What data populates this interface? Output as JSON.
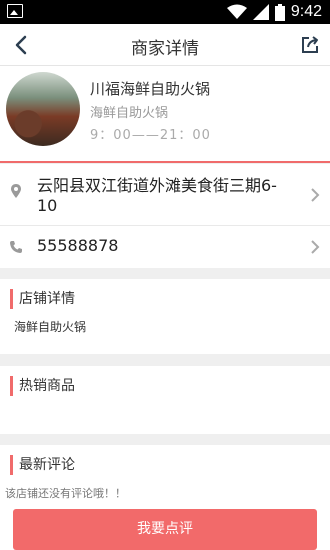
{
  "status_bar": {
    "time": "9:42",
    "icons": [
      "app-notification-icon",
      "wifi-icon",
      "signal-icon",
      "battery-icon"
    ]
  },
  "header": {
    "title": "商家详情",
    "back_icon": "back-arrow-icon",
    "share_icon": "share-icon"
  },
  "merchant": {
    "name": "川福海鲜自助火锅",
    "category": "海鲜自助火锅",
    "hours": "9：00——21：00"
  },
  "contact": {
    "address": "云阳县双江街道外滩美食街三期6-10",
    "phone": "55588878"
  },
  "sections": {
    "shop_details": {
      "title": "店铺详情",
      "body": "海鲜自助火锅"
    },
    "hot_products": {
      "title": "热销商品"
    },
    "latest_reviews": {
      "title": "最新评论",
      "empty_text": "该店铺还没有评论哦！！"
    }
  },
  "actions": {
    "write_review": "我要点评"
  },
  "colors": {
    "accent": "#f06b6b",
    "button": "#f26a6a",
    "background": "#efefef"
  }
}
